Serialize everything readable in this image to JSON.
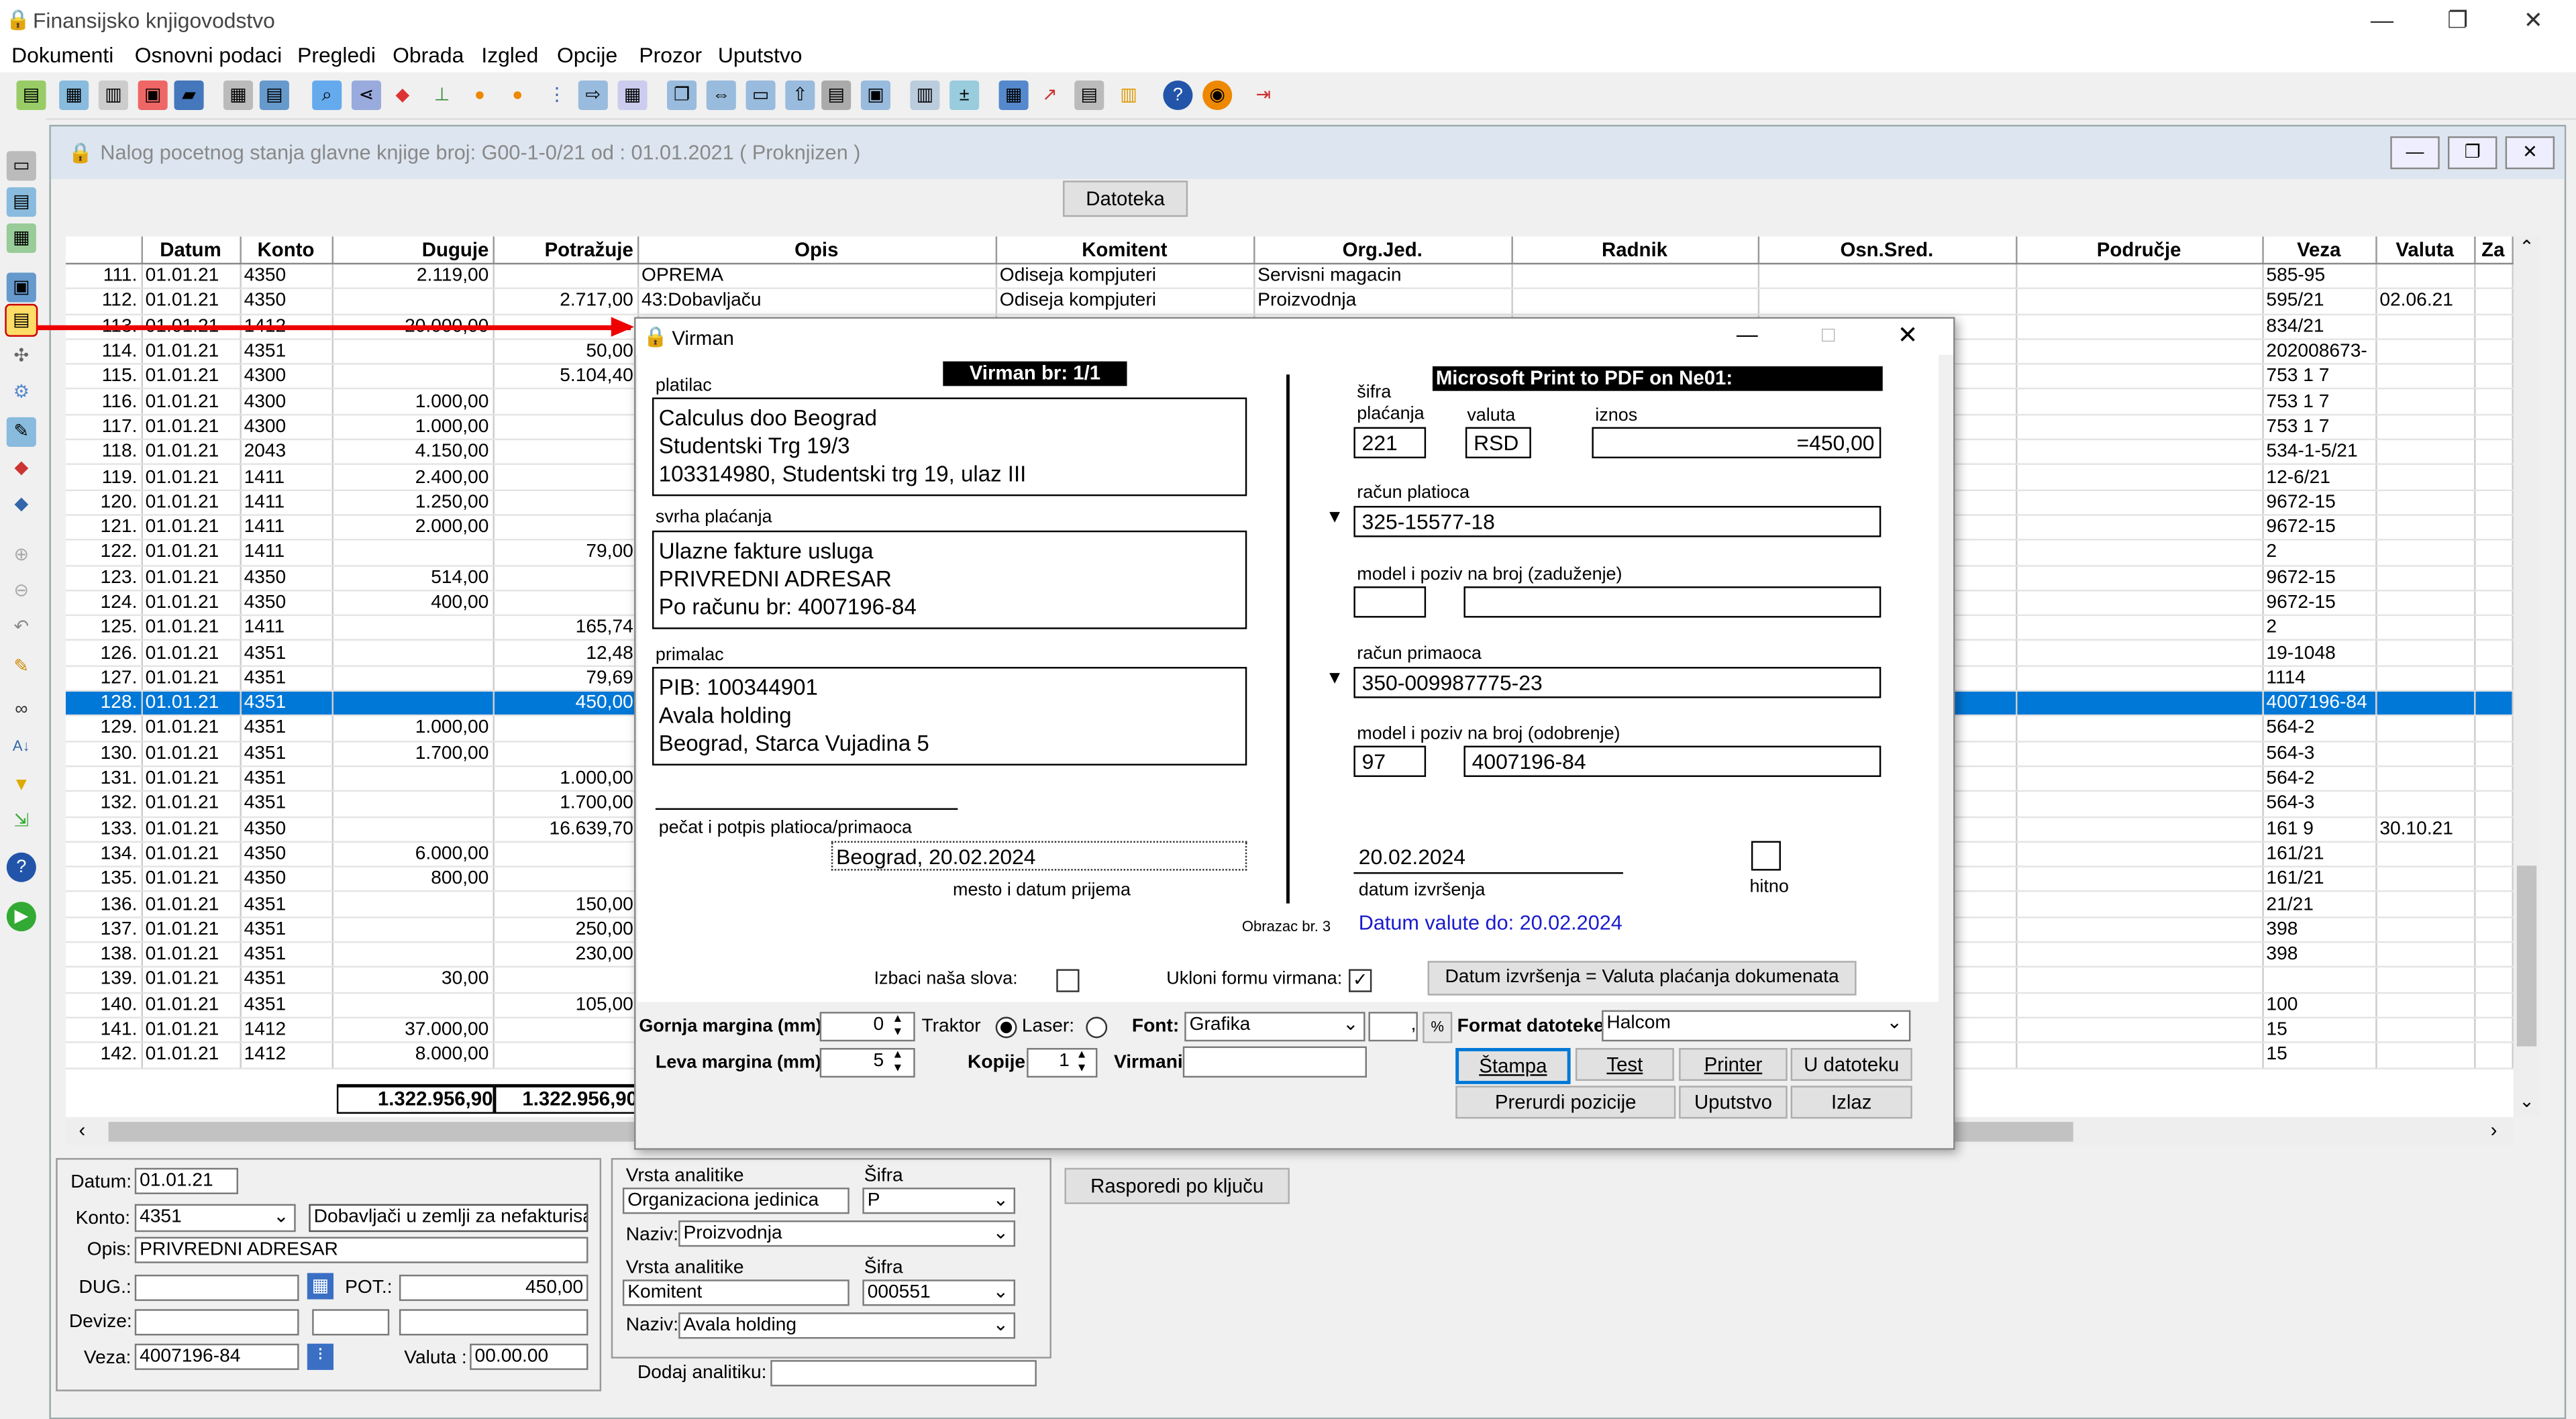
{
  "app": {
    "title": "Finansijsko knjigovodstvo",
    "menu": [
      "Dokumenti",
      "Osnovni podaci",
      "Pregledi",
      "Obrada",
      "Izgled",
      "Opcije",
      "Prozor",
      "Uputstvo"
    ]
  },
  "child": {
    "title": "Nalog pocetnog stanja glavne knjige broj: G00-1-0/21  od : 01.01.2021 ( Proknjizen )",
    "datoteka_button": "Datoteka"
  },
  "grid": {
    "columns": [
      "Datum",
      "Konto",
      "Duguje",
      "Potražuje",
      "Opis",
      "Komitent",
      "Org.Jed.",
      "Radnik",
      "Osn.Sred.",
      "Područje",
      "Veza",
      "Valuta",
      "Za"
    ],
    "rows": [
      [
        "111.",
        "01.01.21",
        "4350",
        "2.119,00",
        "",
        "OPREMA",
        "Odiseja kompjuteri",
        "Servisni magacin",
        "585-95",
        ""
      ],
      [
        "112.",
        "01.01.21",
        "4350",
        "",
        "2.717,00",
        "43:Dobavljaču",
        "Odiseja kompjuteri",
        "Proizvodnja",
        "595/21",
        "02.06.21"
      ],
      [
        "113.",
        "01.01.21",
        "1412",
        "20.000,00",
        "",
        "",
        "",
        "",
        "834/21",
        ""
      ],
      [
        "114.",
        "01.01.21",
        "4351",
        "",
        "50,00",
        "",
        "",
        "",
        "202008673-",
        ""
      ],
      [
        "115.",
        "01.01.21",
        "4300",
        "",
        "5.104,40",
        "",
        "",
        "",
        "753 1 7",
        ""
      ],
      [
        "116.",
        "01.01.21",
        "4300",
        "1.000,00",
        "",
        "",
        "",
        "",
        "753 1 7",
        ""
      ],
      [
        "117.",
        "01.01.21",
        "4300",
        "1.000,00",
        "",
        "",
        "",
        "",
        "753 1 7",
        ""
      ],
      [
        "118.",
        "01.01.21",
        "2043",
        "4.150,00",
        "",
        "",
        "",
        "",
        "534-1-5/21",
        ""
      ],
      [
        "119.",
        "01.01.21",
        "1411",
        "2.400,00",
        "",
        "",
        "",
        "",
        "12-6/21",
        ""
      ],
      [
        "120.",
        "01.01.21",
        "1411",
        "1.250,00",
        "",
        "",
        "",
        "",
        "9672-15",
        ""
      ],
      [
        "121.",
        "01.01.21",
        "1411",
        "2.000,00",
        "",
        "",
        "",
        "",
        "9672-15",
        ""
      ],
      [
        "122.",
        "01.01.21",
        "1411",
        "",
        "79,00",
        "",
        "",
        "",
        "2",
        ""
      ],
      [
        "123.",
        "01.01.21",
        "4350",
        "514,00",
        "",
        "",
        "",
        "",
        "9672-15",
        ""
      ],
      [
        "124.",
        "01.01.21",
        "4350",
        "400,00",
        "",
        "",
        "",
        "",
        "9672-15",
        ""
      ],
      [
        "125.",
        "01.01.21",
        "1411",
        "",
        "165,74",
        "",
        "",
        "",
        "2",
        ""
      ],
      [
        "126.",
        "01.01.21",
        "4351",
        "",
        "12,48",
        "",
        "",
        "",
        "19-1048",
        ""
      ],
      [
        "127.",
        "01.01.21",
        "4351",
        "",
        "79,69",
        "",
        "",
        "",
        "1114",
        ""
      ],
      [
        "128.",
        "01.01.21",
        "4351",
        "",
        "450,00",
        "",
        "",
        "",
        "4007196-84",
        ""
      ],
      [
        "129.",
        "01.01.21",
        "4351",
        "1.000,00",
        "",
        "",
        "",
        "",
        "564-2",
        ""
      ],
      [
        "130.",
        "01.01.21",
        "4351",
        "1.700,00",
        "",
        "",
        "",
        "",
        "564-3",
        ""
      ],
      [
        "131.",
        "01.01.21",
        "4351",
        "",
        "1.000,00",
        "",
        "",
        "",
        "564-2",
        ""
      ],
      [
        "132.",
        "01.01.21",
        "4351",
        "",
        "1.700,00",
        "",
        "",
        "",
        "564-3",
        ""
      ],
      [
        "133.",
        "01.01.21",
        "4350",
        "",
        "16.639,70",
        "",
        "",
        "",
        "161 9",
        "30.10.21"
      ],
      [
        "134.",
        "01.01.21",
        "4350",
        "6.000,00",
        "",
        "",
        "",
        "",
        "161/21",
        ""
      ],
      [
        "135.",
        "01.01.21",
        "4350",
        "800,00",
        "",
        "",
        "",
        "",
        "161/21",
        ""
      ],
      [
        "136.",
        "01.01.21",
        "4351",
        "",
        "150,00",
        "",
        "",
        "",
        "21/21",
        ""
      ],
      [
        "137.",
        "01.01.21",
        "4351",
        "",
        "250,00",
        "",
        "",
        "",
        "398",
        ""
      ],
      [
        "138.",
        "01.01.21",
        "4351",
        "",
        "230,00",
        "",
        "",
        "",
        "398",
        ""
      ],
      [
        "139.",
        "01.01.21",
        "4351",
        "30,00",
        "",
        "",
        "",
        "",
        "",
        ""
      ],
      [
        "140.",
        "01.01.21",
        "4351",
        "",
        "105,00",
        "",
        "",
        "",
        "100",
        ""
      ],
      [
        "141.",
        "01.01.21",
        "1412",
        "37.000,00",
        "",
        "",
        "",
        "",
        "15",
        ""
      ],
      [
        "142.",
        "01.01.21",
        "1412",
        "8.000,00",
        "",
        "",
        "",
        "",
        "15",
        ""
      ]
    ],
    "selected_row": "128.",
    "total_duguje": "1.322.956,90",
    "total_potrazuje": "1.322.956,90"
  },
  "entry": {
    "datum_label": "Datum:",
    "datum": "01.01.21",
    "konto_label": "Konto:",
    "konto": "4351",
    "konto_desc": "Dobavljači u zemlji za nefakturisan",
    "opis_label": "Opis:",
    "opis": "PRIVREDNI ADRESAR",
    "dug_label": "DUG.:",
    "pot_label": "POT.:",
    "pot": "450,00",
    "devize_label": "Devize:",
    "veza_label": "Veza:",
    "veza": "4007196-84",
    "valuta_label": "Valuta :",
    "valuta": "00.00.00",
    "vrsta1_label": "Vrsta analitike",
    "sifra1_label": "Šifra",
    "vrsta1": "Organizaciona jedinica",
    "sifra1": "P",
    "naziv1_label": "Naziv:",
    "naziv1": "Proizvodnja",
    "vrsta2_label": "Vrsta analitike",
    "sifra2_label": "Šifra",
    "vrsta2": "Komitent",
    "sifra2": "000551",
    "naziv2_label": "Naziv:",
    "naziv2": "Avala holding",
    "dodaj_label": "Dodaj analitiku:",
    "rasporedi_button": "Rasporedi po ključu"
  },
  "virman": {
    "title": "Virman",
    "header": "Virman br: 1/1",
    "printer": "Microsoft Print to PDF on Ne01:",
    "platilac_label": "platilac",
    "platilac": [
      "Calculus doo Beograd",
      "Studentski Trg 19/3",
      "103314980, Studentski trg 19, ulaz III"
    ],
    "svrha_label": "svrha plaćanja",
    "svrha": [
      "Ulazne fakture usluga",
      "PRIVREDNI ADRESAR",
      "Po računu br: 4007196-84"
    ],
    "primalac_label": "primalac",
    "primalac": [
      "PIB: 100344901",
      "Avala holding",
      "Beograd, Starca Vujadina 5"
    ],
    "pecat_label": "pečat i potpis platioca/primaoca",
    "mesto": "Beograd, 20.02.2024",
    "mesto_label": "mesto i datum prijema",
    "sifra_label_1": "šifra",
    "sifra_label_2": "plaćanja",
    "valuta_label": "valuta",
    "iznos_label": "iznos",
    "sifra_placanja": "221",
    "valuta": "RSD",
    "iznos": "=450,00",
    "racun_platioca_label": "račun platioca",
    "racun_platioca": "325-15577-18",
    "model_zaduzenje_label": "model i poziv na broj (zaduženje)",
    "racun_primaoca_label": "račun primaoca",
    "racun_primaoca": "350-009987775-23",
    "model_odobrenje_label": "model i poziv na broj (odobrenje)",
    "model_odobrenje": "97",
    "poziv_odobrenje": "4007196-84",
    "datum_izvrsenja": "20.02.2024",
    "datum_izvrsenja_label": "datum izvršenja",
    "hitno_label": "hitno",
    "obrazac": "Obrazac br. 3",
    "datum_valute": "Datum valute do:  20.02.2024",
    "izbaci_label": "Izbaci naša slova:",
    "ukloni_label": "Ukloni formu virmana:",
    "datum_btn": "Datum izvršenja = Valuta plaćanja dokumenata",
    "gornja_label": "Gornja margina (mm):",
    "gornja": "0",
    "leva_label": "Leva margina (mm):",
    "leva": "5",
    "traktor_label": "Traktor",
    "laser_label": "Laser:",
    "font_label": "Font:",
    "font": "Grafika",
    "kopije_label": "Kopije:",
    "kopije": "1",
    "virmani_label": "Virmani:",
    "format_label": "Format datoteke:",
    "format": "Halcom",
    "buttons": [
      "Štampa",
      "Test",
      "Printer",
      "U datoteku",
      "Prerurdi pozicije",
      "Uputstvo",
      "Izlaz"
    ]
  },
  "colors": {
    "selection": "#0078d7",
    "link_blue": "#1a1acc",
    "arrow": "#e00000"
  }
}
